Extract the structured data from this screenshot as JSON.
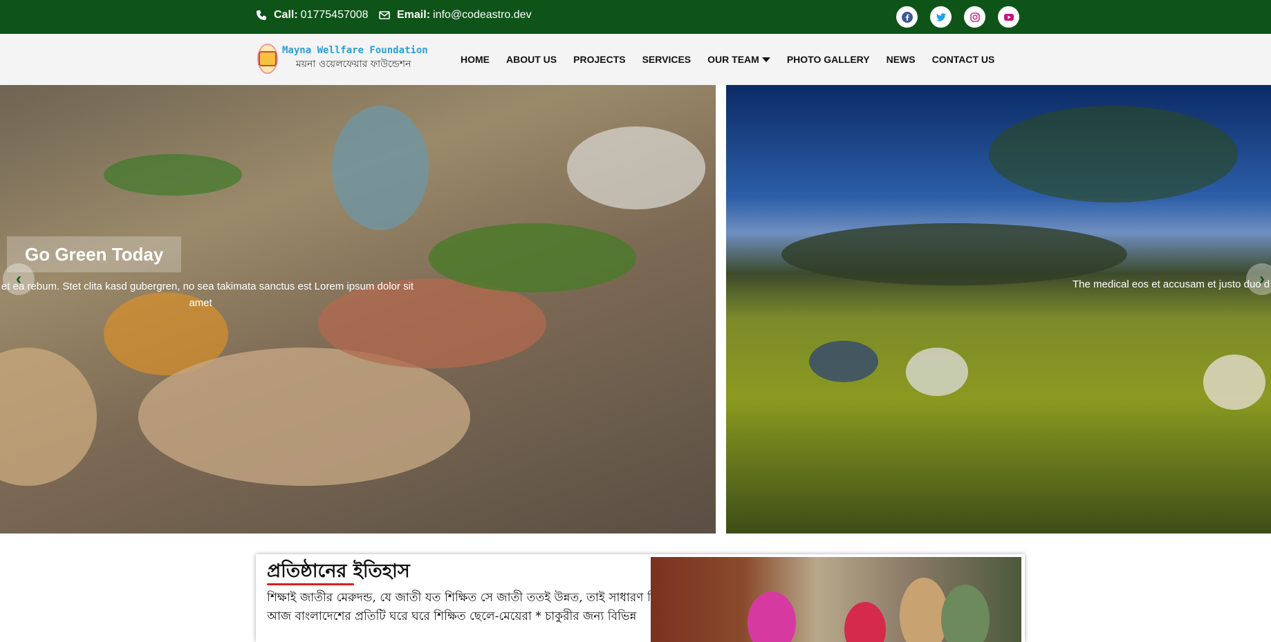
{
  "topbar": {
    "call_label": "Call:",
    "call_value": "01775457008",
    "email_label": "Email:",
    "email_value": "info@codeastro.dev",
    "colors": {
      "background": "#0e5419",
      "text": "#ffffff"
    },
    "socials": [
      {
        "icon": "facebook-icon",
        "color": "#3b5998"
      },
      {
        "icon": "twitter-icon",
        "color": "#1da1f2"
      },
      {
        "icon": "instagram-icon",
        "color": "#c13584"
      },
      {
        "icon": "youtube-icon",
        "color": "#c4138a"
      }
    ]
  },
  "nav": {
    "logo_en": "Mayna Wellfare Foundation",
    "logo_bn": "ময়না ওয়েলফেয়ার ফাউন্ডেশন",
    "items": [
      "HOME",
      "ABOUT US",
      "PROJECTS",
      "SERVICES",
      "OUR TEAM",
      "PHOTO GALLERY",
      "NEWS",
      "CONTACT US"
    ]
  },
  "slider": {
    "slide1_title": "Go Green Today",
    "slide1_text": "es et ea rebum. Stet clita kasd gubergren, no sea takimata sanctus est Lorem ipsum dolor sit amet",
    "slide2_text": "The medical eos et accusam et justo duo d",
    "prev_icon": "chevron-left-icon",
    "next_icon": "chevron-right-icon"
  },
  "about": {
    "title": "প্রতিষ্ঠানের ইতিহাস",
    "text": "শিক্ষাই জাতীর মেরুদন্ড, যে জাতী যত শিক্ষিত সে জাতী ততই উন্নত, তাই সাধারণ শিক্ষার পাশাপাশি কারিগরি শিক্ষার কোন বিকল্প নাই । আজ বাংলাদেশের প্রতিটি ঘরে ঘরে শিক্ষিত ছেলে-মেয়েরা * চাকুরীর জন্য বিভিন্ন",
    "accent_color": "#d61f1f"
  }
}
